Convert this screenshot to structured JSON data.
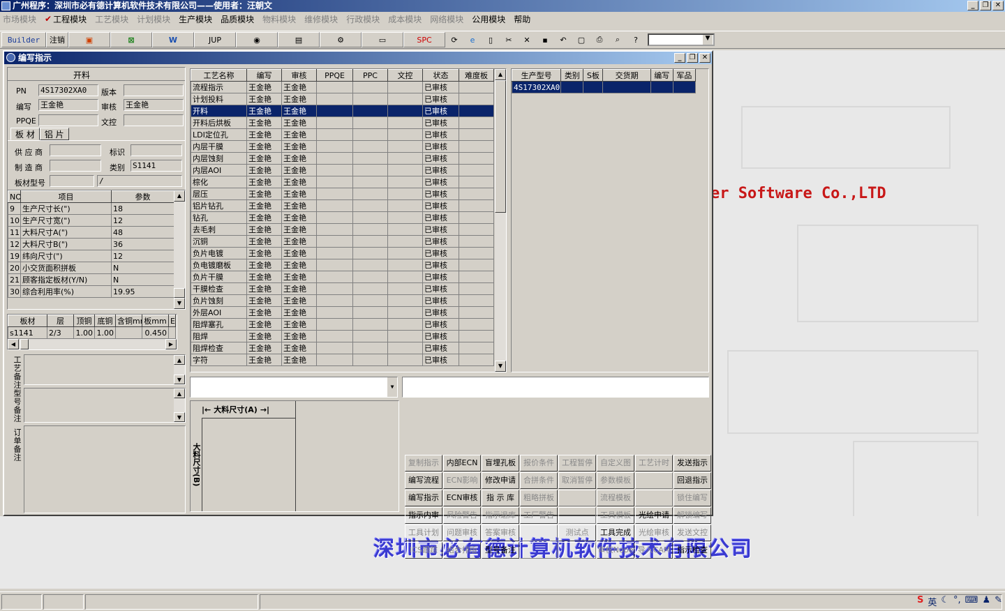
{
  "app": {
    "title": "广州程序：深圳市必有德计算机软件技术有限公司——使用者：汪朝文"
  },
  "menu": [
    {
      "label": "市场模块",
      "disabled": true
    },
    {
      "label": "工程模块",
      "disabled": false,
      "checked": true
    },
    {
      "label": "工艺模块",
      "disabled": true
    },
    {
      "label": "计划模块",
      "disabled": true
    },
    {
      "label": "生产模块",
      "disabled": false
    },
    {
      "label": "品质模块",
      "disabled": false
    },
    {
      "label": "物料模块",
      "disabled": true
    },
    {
      "label": "维修模块",
      "disabled": true
    },
    {
      "label": "行政模块",
      "disabled": true
    },
    {
      "label": "成本模块",
      "disabled": true
    },
    {
      "label": "网络模块",
      "disabled": true
    },
    {
      "label": "公用模块",
      "disabled": false
    },
    {
      "label": "帮助",
      "disabled": false
    }
  ],
  "toolbar": {
    "builder": "Builder",
    "logout": "注销",
    "jup": "JUP",
    "spc": "SPC"
  },
  "window": {
    "title": "编写指示"
  },
  "left": {
    "process": "开料",
    "pn_label": "PN",
    "pn": "4S17302XA0",
    "version_label": "版本",
    "version": "",
    "writer_label": "编写",
    "writer": "王金艳",
    "reviewer_label": "审核",
    "reviewer": "王金艳",
    "ppqe_label": "PPQE",
    "ppqe": "",
    "dc_label": "文控",
    "dc": "",
    "tabs": [
      "板 材",
      "铝 片"
    ],
    "supplier_label": "供 应 商",
    "supplier": "",
    "mark_label": "标识",
    "mark": "",
    "maker_label": "制 造 商",
    "maker": "",
    "type_label": "类别",
    "type": "S1141",
    "model_label": "板材型号",
    "model": "",
    "model2": "/",
    "param_headers": [
      "NO",
      "项目",
      "参数"
    ],
    "params": [
      [
        "9",
        "生产尺寸长(\")",
        "18"
      ],
      [
        "10",
        "生产尺寸宽(\")",
        "12"
      ],
      [
        "11",
        "大料尺寸A(\")",
        "48"
      ],
      [
        "12",
        "大料尺寸B(\")",
        "36"
      ],
      [
        "19",
        "纬向尺寸(\")",
        "12"
      ],
      [
        "20",
        "小交货面积拼板",
        "N"
      ],
      [
        "21",
        "顾客指定板材(Y/N)",
        "N"
      ],
      [
        "30",
        "综合利用率(%)",
        "19.95"
      ]
    ],
    "board_headers": [
      "板材",
      "层",
      "顶铜",
      "底铜",
      "含铜mm",
      "板mm",
      "E"
    ],
    "board": [
      "s1141",
      "2/3",
      "1.00",
      "1.00",
      "",
      "0.450",
      ""
    ],
    "memo_labels": [
      "工艺备注",
      "型号备注",
      "订单备注"
    ]
  },
  "process_grid": {
    "headers": [
      "工艺名称",
      "编写",
      "审核",
      "PPQE",
      "PPC",
      "文控",
      "状态",
      "难度板"
    ],
    "rows": [
      [
        "流程指示",
        "王金艳",
        "王金艳",
        "",
        "",
        "",
        "已审核",
        ""
      ],
      [
        "计划投料",
        "王金艳",
        "王金艳",
        "",
        "",
        "",
        "已审核",
        ""
      ],
      [
        "开料",
        "王金艳",
        "王金艳",
        "",
        "",
        "",
        "已审核",
        ""
      ],
      [
        "开料后烘板",
        "王金艳",
        "王金艳",
        "",
        "",
        "",
        "已审核",
        ""
      ],
      [
        "LDI定位孔",
        "王金艳",
        "王金艳",
        "",
        "",
        "",
        "已审核",
        ""
      ],
      [
        "内层干膜",
        "王金艳",
        "王金艳",
        "",
        "",
        "",
        "已审核",
        ""
      ],
      [
        "内层蚀刻",
        "王金艳",
        "王金艳",
        "",
        "",
        "",
        "已审核",
        ""
      ],
      [
        "内层AOI",
        "王金艳",
        "王金艳",
        "",
        "",
        "",
        "已审核",
        ""
      ],
      [
        "棕化",
        "王金艳",
        "王金艳",
        "",
        "",
        "",
        "已审核",
        ""
      ],
      [
        "层压",
        "王金艳",
        "王金艳",
        "",
        "",
        "",
        "已审核",
        ""
      ],
      [
        "铝片钻孔",
        "王金艳",
        "王金艳",
        "",
        "",
        "",
        "已审核",
        ""
      ],
      [
        "钻孔",
        "王金艳",
        "王金艳",
        "",
        "",
        "",
        "已审核",
        ""
      ],
      [
        "去毛刺",
        "王金艳",
        "王金艳",
        "",
        "",
        "",
        "已审核",
        ""
      ],
      [
        "沉铜",
        "王金艳",
        "王金艳",
        "",
        "",
        "",
        "已审核",
        ""
      ],
      [
        "负片电镀",
        "王金艳",
        "王金艳",
        "",
        "",
        "",
        "已审核",
        ""
      ],
      [
        "负电镀磨板",
        "王金艳",
        "王金艳",
        "",
        "",
        "",
        "已审核",
        ""
      ],
      [
        "负片干膜",
        "王金艳",
        "王金艳",
        "",
        "",
        "",
        "已审核",
        ""
      ],
      [
        "干膜检查",
        "王金艳",
        "王金艳",
        "",
        "",
        "",
        "已审核",
        ""
      ],
      [
        "负片蚀刻",
        "王金艳",
        "王金艳",
        "",
        "",
        "",
        "已审核",
        ""
      ],
      [
        "外层AOI",
        "王金艳",
        "王金艳",
        "",
        "",
        "",
        "已审核",
        ""
      ],
      [
        "阻焊塞孔",
        "王金艳",
        "王金艳",
        "",
        "",
        "",
        "已审核",
        ""
      ],
      [
        "阻焊",
        "王金艳",
        "王金艳",
        "",
        "",
        "",
        "已审核",
        ""
      ],
      [
        "阻焊检查",
        "王金艳",
        "王金艳",
        "",
        "",
        "",
        "已审核",
        ""
      ],
      [
        "字符",
        "王金艳",
        "王金艳",
        "",
        "",
        "",
        "已审核",
        ""
      ]
    ],
    "selected": 2
  },
  "model_grid": {
    "headers": [
      "生产型号",
      "类别",
      "S板",
      "交货期",
      "编写",
      "军品"
    ],
    "rows": [
      [
        "4S17302XA0",
        "",
        "",
        "",
        "",
        ""
      ]
    ]
  },
  "diagram": {
    "a_label": "大料尺寸(A)",
    "b_label": "大料尺寸(B)"
  },
  "buttons": [
    {
      "label": "复制指示",
      "disabled": true
    },
    {
      "label": "内部ECN",
      "disabled": false
    },
    {
      "label": "盲埋孔板",
      "disabled": false
    },
    {
      "label": "报价条件",
      "disabled": true
    },
    {
      "label": "工程暂停",
      "disabled": true
    },
    {
      "label": "自定义图",
      "disabled": true
    },
    {
      "label": "工艺计时",
      "disabled": true
    },
    {
      "label": "发送指示",
      "disabled": false
    },
    {
      "label": "编写流程",
      "disabled": false
    },
    {
      "label": "ECN影响",
      "disabled": true
    },
    {
      "label": "修改申请",
      "disabled": false
    },
    {
      "label": "合拼条件",
      "disabled": true
    },
    {
      "label": "取消暂停",
      "disabled": true
    },
    {
      "label": "参数模板",
      "disabled": true
    },
    {
      "label": "",
      "disabled": true
    },
    {
      "label": "回退指示",
      "disabled": false
    },
    {
      "label": "编写指示",
      "disabled": false
    },
    {
      "label": "ECN审核",
      "disabled": false
    },
    {
      "label": "指 示 库",
      "disabled": false
    },
    {
      "label": "粗略拼板",
      "disabled": true
    },
    {
      "label": "",
      "disabled": true
    },
    {
      "label": "流程模板",
      "disabled": true
    },
    {
      "label": "",
      "disabled": true
    },
    {
      "label": "锁住编写",
      "disabled": true
    },
    {
      "label": "指示内审",
      "disabled": false
    },
    {
      "label": "风险警告",
      "disabled": true
    },
    {
      "label": "指示退库",
      "disabled": true
    },
    {
      "label": "工厂警告",
      "disabled": true
    },
    {
      "label": "",
      "disabled": true
    },
    {
      "label": "工具模板",
      "disabled": true
    },
    {
      "label": "光绘申请",
      "disabled": false
    },
    {
      "label": "解锁编写",
      "disabled": true
    },
    {
      "label": "工具计划",
      "disabled": true
    },
    {
      "label": "问题审核",
      "disabled": true
    },
    {
      "label": "答案审核",
      "disabled": true
    },
    {
      "label": "",
      "disabled": true
    },
    {
      "label": "测试点",
      "disabled": true
    },
    {
      "label": "工具完成",
      "disabled": false
    },
    {
      "label": "光绘审核",
      "disabled": true
    },
    {
      "label": "发送文控",
      "disabled": true
    },
    {
      "label": "ICS跟踪",
      "disabled": true
    },
    {
      "label": "组合排版",
      "disabled": true
    },
    {
      "label": "型号备注",
      "disabled": false
    },
    {
      "label": "",
      "disabled": true
    },
    {
      "label": "",
      "disabled": true
    },
    {
      "label": "审核Nope",
      "disabled": true
    },
    {
      "label": "导入CAM",
      "disabled": true
    },
    {
      "label": "指示检查",
      "disabled": false
    }
  ],
  "background": {
    "slogan_en": "er Software Co.,LTD",
    "slogan_cn": "深圳市必有德计算机软件技术有限公司"
  },
  "tray": {
    "ime": "英"
  }
}
